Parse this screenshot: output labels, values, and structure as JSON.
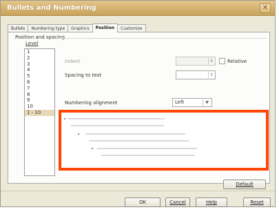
{
  "window": {
    "title": "Bullets and Numbering",
    "close_glyph": "✕"
  },
  "tabs": [
    {
      "label": "Bullets"
    },
    {
      "label": "Numbering type"
    },
    {
      "label": "Graphics"
    },
    {
      "label": "Position"
    },
    {
      "label": "Customize"
    }
  ],
  "active_tab": "Position",
  "section": {
    "title": "Position and spacing",
    "level_label": "Level"
  },
  "levels": [
    "1",
    "2",
    "3",
    "4",
    "5",
    "6",
    "7",
    "8",
    "9",
    "10",
    "1 - 10"
  ],
  "selected_level": "1 - 10",
  "fields": {
    "indent_label": "Indent",
    "indent_value": "",
    "relative_label": "Relative",
    "relative_checked": false,
    "spacing_label": "Spacing to text",
    "spacing_value": "",
    "alignment_label": "Numbering alignment",
    "alignment_value": "Left"
  },
  "buttons": {
    "default": "Default",
    "ok": "OK",
    "cancel": "Cancel",
    "help": "Help",
    "reset": "Reset"
  },
  "colors": {
    "highlight_border": "#ff4500",
    "title_bar": "#d6b46e",
    "selected_level_bg": "#e7d9b8"
  }
}
